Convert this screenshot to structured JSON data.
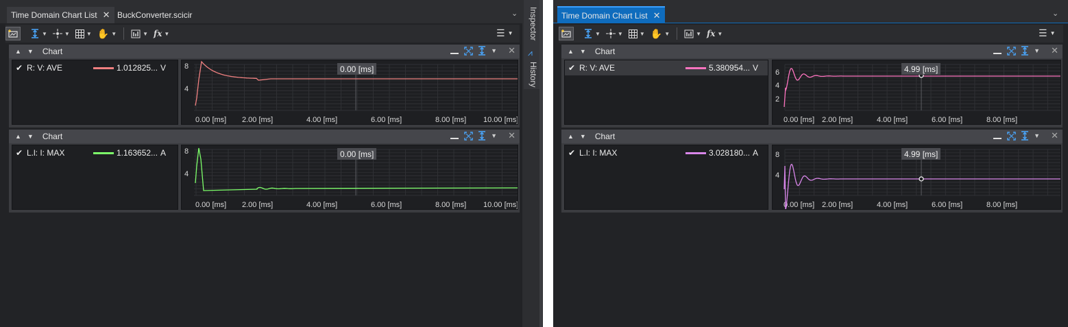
{
  "left": {
    "tabs": [
      {
        "label": "Time Domain Chart List",
        "active": true
      },
      {
        "label": "BuckConverter.scicir",
        "active": false
      }
    ],
    "charts": [
      {
        "title": "Chart",
        "signal": {
          "name": "R: V: AVE",
          "value": "1.012825...",
          "unit": "V",
          "color": "#f08080"
        },
        "cursor_label": "0.00 [ms]",
        "y_ticks": [
          "8",
          "4"
        ],
        "x_ticks": [
          "0.00 [ms]",
          "2.00 [ms]",
          "4.00 [ms]",
          "6.00 [ms]",
          "8.00 [ms]",
          "10.00 [ms]"
        ]
      },
      {
        "title": "Chart",
        "signal": {
          "name": "L.l: I: MAX",
          "value": "1.163652...",
          "unit": "A",
          "color": "#7dff6a"
        },
        "cursor_label": "0.00 [ms]",
        "y_ticks": [
          "8",
          "4"
        ],
        "x_ticks": [
          "0.00 [ms]",
          "2.00 [ms]",
          "4.00 [ms]",
          "6.00 [ms]",
          "8.00 [ms]",
          "10.00 [ms]"
        ]
      }
    ]
  },
  "side_panel": {
    "inspector": "Inspector",
    "history": "History"
  },
  "right": {
    "tabs": [
      {
        "label": "Time Domain Chart List",
        "active": true
      }
    ],
    "charts": [
      {
        "title": "Chart",
        "signal": {
          "name": "R: V: AVE",
          "value": "5.380954...",
          "unit": "V",
          "color": "#ff74c0"
        },
        "cursor_label": "4.99 [ms]",
        "y_ticks": [
          "6",
          "4",
          "2"
        ],
        "x_ticks": [
          "0.00 [ms]",
          "2.00 [ms]",
          "4.00 [ms]",
          "6.00 [ms]",
          "8.00 [ms]"
        ]
      },
      {
        "title": "Chart",
        "signal": {
          "name": "L.l: I: MAX",
          "value": "3.028180...",
          "unit": "A",
          "color": "#d986ea"
        },
        "cursor_label": "4.99 [ms]",
        "y_ticks": [
          "8",
          "4"
        ],
        "x_ticks": [
          "0.00 [ms]",
          "2.00 [ms]",
          "4.00 [ms]",
          "6.00 [ms]",
          "8.00 [ms]"
        ]
      }
    ]
  },
  "toolbar": {
    "fx_label": "fx"
  },
  "icons": [
    "add-chart-icon",
    "fit-vertical-icon",
    "crosshair-icon",
    "grid-icon",
    "pan-hand-icon",
    "chart-type-icon",
    "function-icon",
    "menu-icon",
    "minimize-icon",
    "fit-all-icon",
    "fit-y-icon",
    "close-icon",
    "collapse-icon",
    "expand-icon",
    "check-icon",
    "history-icon"
  ]
}
